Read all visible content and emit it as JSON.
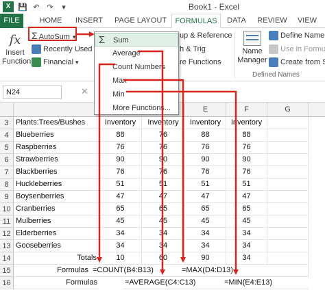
{
  "title": "Book1 - Excel",
  "qat": {
    "logo": "X",
    "save": "💾",
    "undo": "↶",
    "redo": "↷",
    "more": "▾"
  },
  "tabs": [
    "FILE",
    "HOME",
    "INSERT",
    "PAGE LAYOUT",
    "FORMULAS",
    "DATA",
    "REVIEW",
    "VIEW"
  ],
  "active_tab": "FORMULAS",
  "ribbon": {
    "insert_function_line1": "Insert",
    "insert_function_line2": "Function",
    "fx": "fx",
    "autosum": "AutoSum",
    "recently_used": "Recently Used",
    "financial": "Financial",
    "lookup_reference": "up & Reference",
    "math_trig": "h & Trig",
    "more_functions": "re Functions",
    "name_manager_line1": "Name",
    "name_manager_line2": "Manager",
    "define_name": "Define Name",
    "use_in_formula": "Use in Formula",
    "create_from_selection": "Create from Sel",
    "defined_names_label": "Defined Names"
  },
  "autosum_menu": [
    "Sum",
    "Average",
    "Count Numbers",
    "Max",
    "Min",
    "More Functions..."
  ],
  "formula_bar": {
    "name_box": "N24",
    "cancel": "✕"
  },
  "columns": [
    "E",
    "F",
    "G"
  ],
  "rows": [
    "3",
    "4",
    "5",
    "6",
    "7",
    "8",
    "9",
    "10",
    "11",
    "12",
    "13",
    "14",
    "15",
    "16"
  ],
  "sheet": {
    "header": [
      "Plants:Trees/Bushes",
      "Inventory",
      "Inventory",
      "Inventory",
      "Inventory"
    ],
    "items": [
      {
        "name": "Blueberries",
        "b": "88",
        "c": "76",
        "d": "88",
        "e": "88"
      },
      {
        "name": "Raspberries",
        "b": "76",
        "c": "76",
        "d": "76",
        "e": "76"
      },
      {
        "name": "Strawberries",
        "b": "90",
        "c": "90",
        "d": "90",
        "e": "90"
      },
      {
        "name": "Blackberries",
        "b": "76",
        "c": "76",
        "d": "76",
        "e": "76"
      },
      {
        "name": "Huckleberries",
        "b": "51",
        "c": "51",
        "d": "51",
        "e": "51"
      },
      {
        "name": "Boysenberries",
        "b": "47",
        "c": "47",
        "d": "47",
        "e": "47"
      },
      {
        "name": "Cranberries",
        "b": "65",
        "c": "65",
        "d": "65",
        "e": "65"
      },
      {
        "name": "Mulberries",
        "b": "45",
        "c": "45",
        "d": "45",
        "e": "45"
      },
      {
        "name": "Elderberries",
        "b": "34",
        "c": "34",
        "d": "34",
        "e": "34"
      },
      {
        "name": "Gooseberries",
        "b": "34",
        "c": "34",
        "d": "34",
        "e": "34"
      }
    ],
    "totals": {
      "label": "Totals",
      "b": "10",
      "c": "60",
      "d": "90",
      "e": "34"
    },
    "formulas_row15": {
      "label": "Formulas",
      "count": "=COUNT(B4:B13)",
      "max": "=MAX(D4:D13)"
    },
    "formulas_row16": {
      "label": "Formulas",
      "average": "=AVERAGE(C4:C13)",
      "min": "=MIN(E4:E13)"
    }
  },
  "colors": {
    "excel_green": "#217346",
    "arrow_red": "#d9241c",
    "hover_green": "#e1f0e6"
  }
}
